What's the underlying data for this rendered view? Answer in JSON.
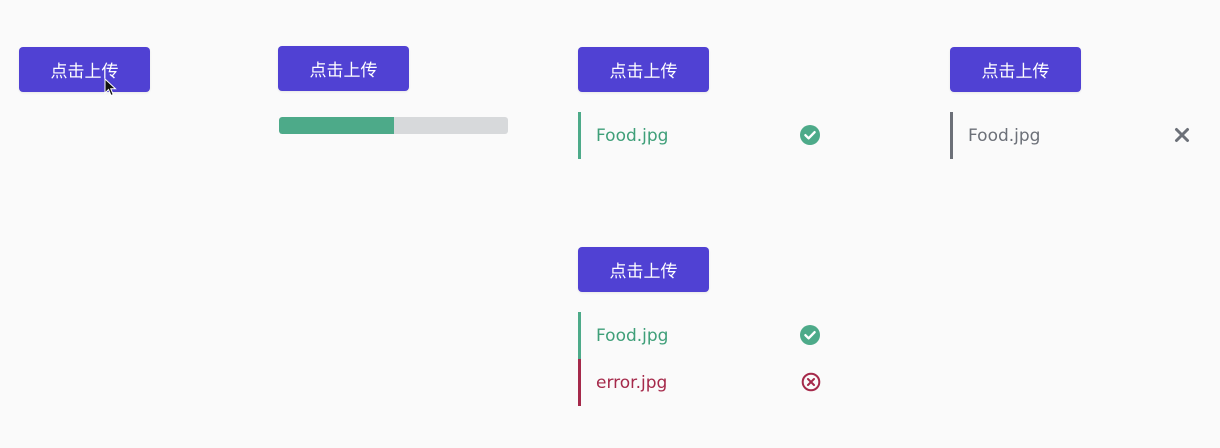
{
  "upload_button_label": "点击上传",
  "progress": {
    "percent": 50
  },
  "success_panel": {
    "file_name": "Food.jpg",
    "status_icon": "check-circle-icon"
  },
  "removable_panel": {
    "file_name": "Food.jpg",
    "action_icon": "close-icon"
  },
  "mixed_panel": {
    "files": [
      {
        "name": "Food.jpg",
        "status": "success",
        "status_icon": "check-circle-icon"
      },
      {
        "name": "error.jpg",
        "status": "error",
        "status_icon": "error-circle-icon"
      }
    ]
  },
  "colors": {
    "button": "#5041d3",
    "success": "#4daa89",
    "error": "#a5294a",
    "neutral": "#6c7078",
    "progress_track": "#d7d9db"
  }
}
